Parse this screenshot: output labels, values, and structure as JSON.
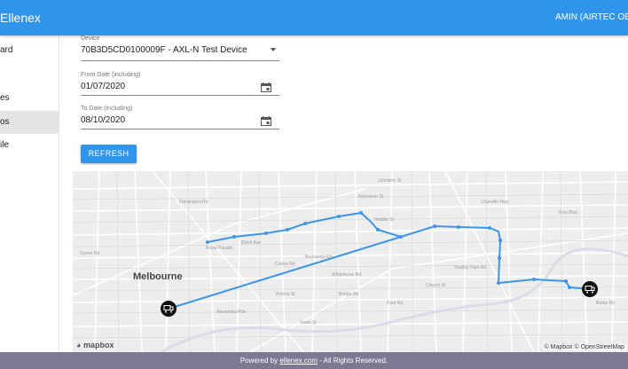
{
  "header": {
    "brand": "Ellenex",
    "user": "AMIN (AIRTEC OBM"
  },
  "sidebar": {
    "items": [
      {
        "label": "ard"
      },
      {
        "label": "es"
      },
      {
        "label": "os"
      },
      {
        "label": "ile"
      }
    ]
  },
  "form": {
    "device": {
      "label": "Device",
      "value": "70B3D5CD0100009F - AXL-N Test Device"
    },
    "from": {
      "label": "From Date (including)",
      "value": "01/07/2020"
    },
    "to": {
      "label": "To Date (including)",
      "value": "08/10/2020"
    },
    "refresh_label": "REFRESH"
  },
  "map": {
    "city_label": "Melbourne",
    "mapbox_logo": "mapbox",
    "attribution": "© Mapbox © OpenStreetMap",
    "route_color": "#3d95e8",
    "streets": [
      "Dynon Rd",
      "Flemington Rd",
      "Royal Parade",
      "Elliott Ave",
      "Cotton Rd",
      "Brunswick Rd",
      "Nicholson St",
      "Johnston St",
      "Whitehorse Rd",
      "Alexandra Pde",
      "Victoria St",
      "Bridge Rd",
      "Swan St",
      "Punt Rd",
      "Church St",
      "Studley Park Rd",
      "Hoddle St",
      "Chandler Hwy",
      "Kew Blvd",
      "Burke Rd"
    ]
  },
  "footer": {
    "prefix": "Powered by ",
    "link": "ellenex.com",
    "suffix": " - All Rights Reserved."
  }
}
